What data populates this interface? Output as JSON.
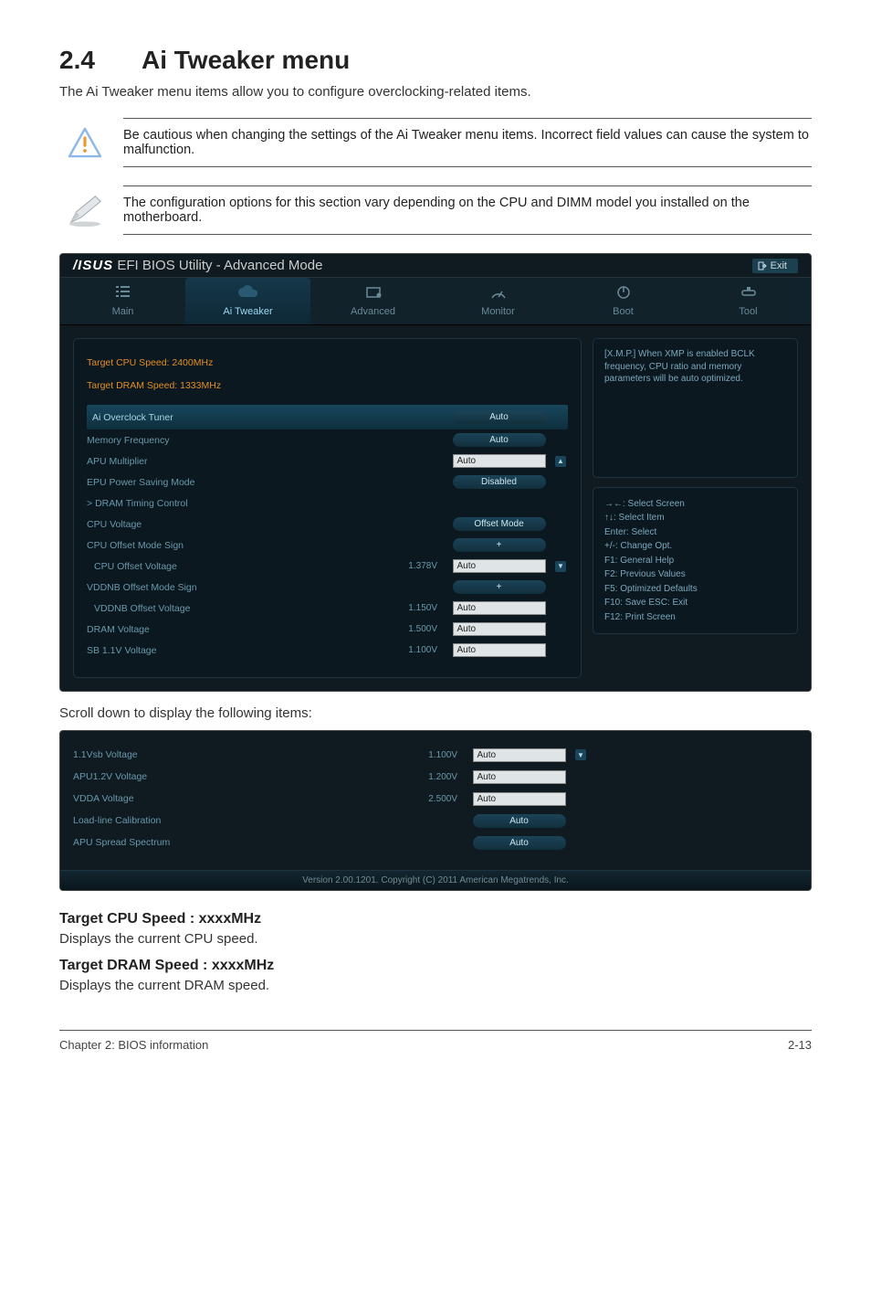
{
  "heading": {
    "number": "2.4",
    "title": "Ai Tweaker menu"
  },
  "intro": "The Ai Tweaker menu items allow you to configure overclocking-related items.",
  "note1": "Be cautious when changing the settings of the Ai Tweaker menu items. Incorrect field values can cause the system to malfunction.",
  "note2": "The configuration options for this section vary depending on the CPU and DIMM model you installed on the motherboard.",
  "bios": {
    "brand_util": "EFI BIOS Utility - Advanced Mode",
    "exit": "Exit",
    "tabs": {
      "main": "Main",
      "ai": "Ai  Tweaker",
      "advanced": "Advanced",
      "monitor": "Monitor",
      "boot": "Boot",
      "tool": "Tool"
    },
    "header1": "Target CPU Speed: 2400MHz",
    "header2": "Target DRAM Speed: 1333MHz",
    "rows": {
      "ai_overclock": "Ai Overclock Tuner",
      "mem_freq": "Memory Frequency",
      "apu_mult": "APU Multiplier",
      "epu": "EPU Power Saving Mode",
      "dram_timing": "DRAM Timing Control",
      "cpu_v": "CPU Voltage",
      "cpu_off_sign": "CPU Offset Mode Sign",
      "cpu_off_v": "CPU Offset Voltage",
      "vddnb_sign": "VDDNB Offset Mode Sign",
      "vddnb_v": "VDDNB Offset Voltage",
      "dram_v": "DRAM Voltage",
      "sb11": "SB 1.1V Voltage"
    },
    "vals": {
      "auto": "Auto",
      "disabled": "Disabled",
      "offset_mode": "Offset Mode",
      "plus": "+",
      "v1378": "1.378V",
      "v1150": "1.150V",
      "v1500": "1.500V",
      "v1100": "1.100V"
    },
    "help_text": "[X.M.P.] When XMP is enabled BCLK frequency, CPU ratio and memory parameters will be auto optimized.",
    "hints": {
      "l1": "→←:  Select Screen",
      "l2": "↑↓:  Select Item",
      "l3": "Enter:  Select",
      "l4": "+/-:  Change Opt.",
      "l5": "F1:  General Help",
      "l6": "F2:  Previous Values",
      "l7": "F5:  Optimized Defaults",
      "l8": "F10:  Save    ESC:  Exit",
      "l9": "F12:  Print Screen"
    }
  },
  "mid_text": "Scroll down to display the following items:",
  "bios2": {
    "rows": {
      "v11sb": "1.1Vsb Voltage",
      "apu12": "APU1.2V Voltage",
      "vdda": "VDDA Voltage",
      "loadline": "Load-line Calibration",
      "apu_spread": "APU Spread Spectrum"
    },
    "vals": {
      "v1100": "1.100V",
      "v1200": "1.200V",
      "v2500": "2.500V",
      "auto": "Auto"
    },
    "copyright": "Version  2.00.1201.   Copyright  (C)  2011  American  Megatrends,  Inc."
  },
  "sections": {
    "cpu_heading": "Target CPU Speed : xxxxMHz",
    "cpu_text": "Displays the current CPU speed.",
    "dram_heading": "Target DRAM Speed : xxxxMHz",
    "dram_text": "Displays the current DRAM speed."
  },
  "footer": {
    "left": "Chapter 2: BIOS information",
    "right": "2-13"
  }
}
